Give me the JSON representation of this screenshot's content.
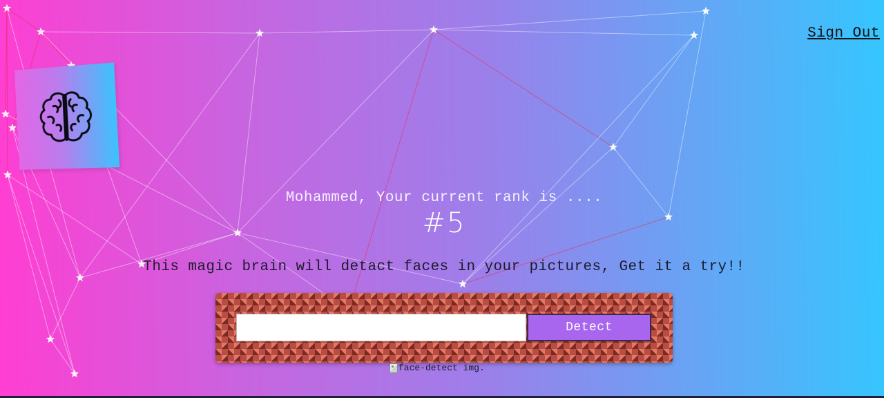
{
  "header": {
    "signout_label": "Sign Out"
  },
  "logo": {
    "icon": "brain-icon"
  },
  "rank": {
    "message": "Mohammed, Your current rank is ....",
    "value": "#5"
  },
  "tagline": "This magic brain will detact faces in your pictures, Get it a try!!",
  "form": {
    "input_value": "",
    "input_placeholder": "",
    "detect_label": "Detect"
  },
  "image": {
    "alt_text": "face-detect img."
  },
  "colors": {
    "gradient_left": "#ff3ed2",
    "gradient_right": "#35c6ff",
    "detect_button": "#a866ee",
    "form_pattern": "#b94d42"
  }
}
